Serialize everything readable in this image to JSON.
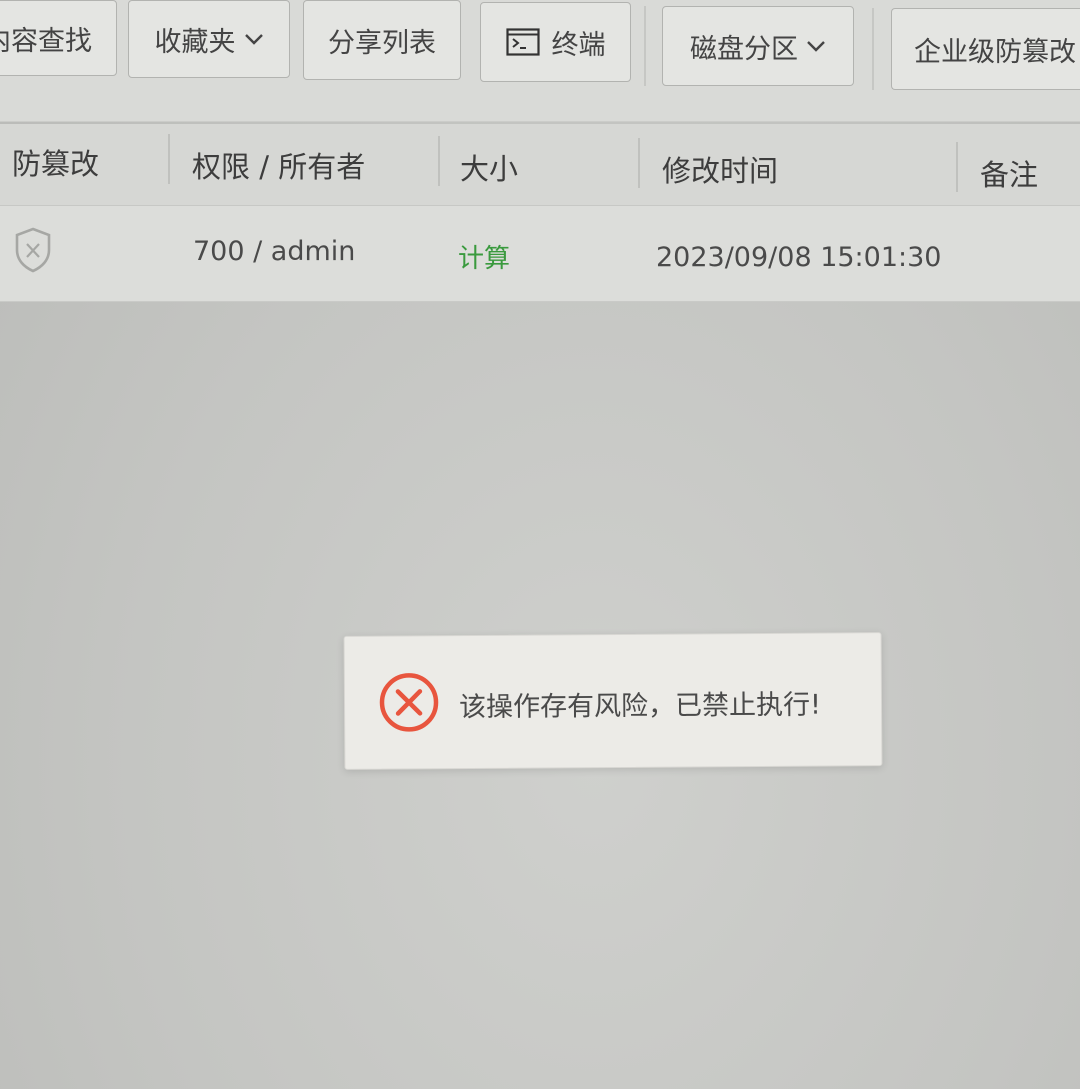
{
  "toolbar": {
    "content_search": "内容查找",
    "favorites": "收藏夹",
    "share_list": "分享列表",
    "terminal": "终端",
    "disk_partition": "磁盘分区",
    "enterprise_tamper": "企业级防篡改"
  },
  "table": {
    "headers": {
      "tamper": "防篡改",
      "permission_owner": "权限 / 所有者",
      "size": "大小",
      "modified_time": "修改时间",
      "remark": "备注"
    },
    "rows": [
      {
        "tamper_icon": "shield-x-icon",
        "permission_owner": "700 / admin",
        "size": "计算",
        "modified_time": "2023/09/08 15:01:30",
        "remark": ""
      }
    ]
  },
  "toast": {
    "icon": "error-circle-icon",
    "message": "该操作存有风险，已禁止执行!",
    "icon_color": "#e8553e"
  },
  "colors": {
    "size_link": "#3a9a3e"
  }
}
